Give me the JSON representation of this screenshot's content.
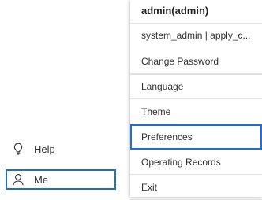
{
  "sidebar": {
    "items": [
      {
        "label": "Help",
        "icon": "lightbulb-icon"
      },
      {
        "label": "Me",
        "icon": "person-icon"
      }
    ]
  },
  "menu": {
    "title": "admin(admin)",
    "subtitle": "system_admin | apply_c...",
    "items": [
      {
        "label": "Change Password"
      },
      {
        "label": "Language"
      },
      {
        "label": "Theme"
      },
      {
        "label": "Preferences"
      },
      {
        "label": "Operating Records"
      },
      {
        "label": "Exit"
      }
    ]
  },
  "colors": {
    "accent": "#1a6fd6",
    "divider": "#e1e1e1",
    "text": "#323130"
  }
}
